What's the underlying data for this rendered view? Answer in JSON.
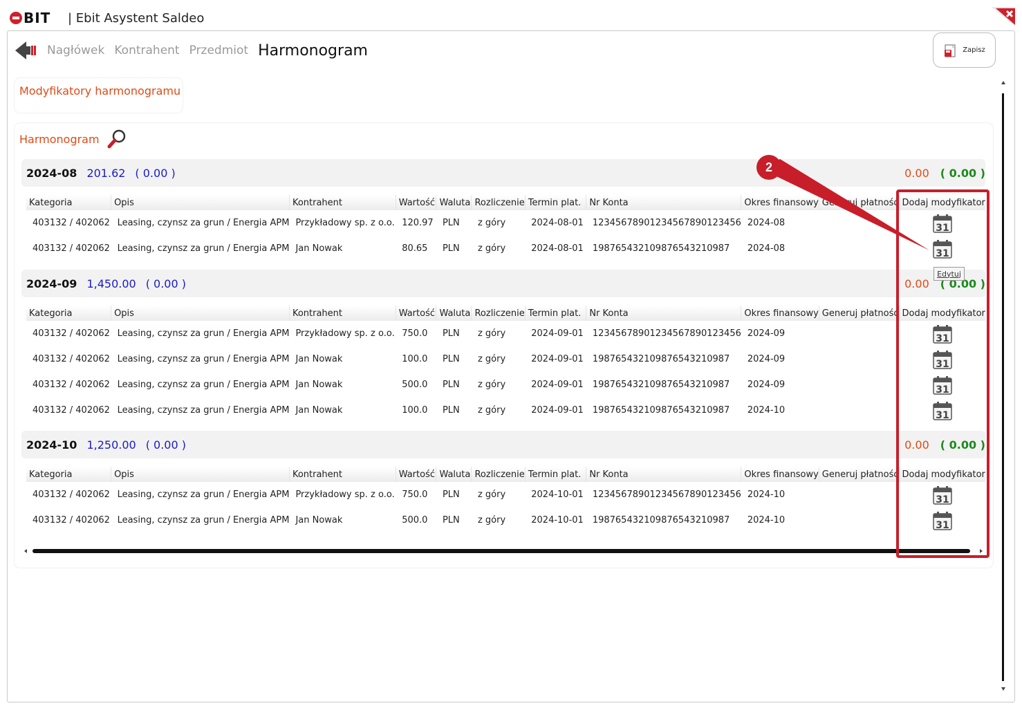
{
  "titlebar": {
    "logo": "BIT",
    "title": "| Ebit Asystent Saldeo"
  },
  "nav": {
    "tabs": [
      "Nagłówek",
      "Kontrahent",
      "Przedmiot"
    ],
    "active": "Harmonogram"
  },
  "toolbar": {
    "save_label": "Zapisz"
  },
  "modifiers_title": "Modyfikatory harmonogramu",
  "harmonogram_title": "Harmonogram",
  "columns": [
    "Kategoria",
    "Opis",
    "Kontrahent",
    "Wartość",
    "Waluta",
    "Rozliczenie",
    "Termin plat.",
    "Nr Konta",
    "Okres finansowy",
    "Generuj płatność",
    "Dodaj modyfikator"
  ],
  "groups": [
    {
      "period": "2024-08",
      "sum": "201.62",
      "paid": "( 0.00 )",
      "right_sum": "0.00",
      "right_paid": "( 0.00 )",
      "rows": [
        [
          "403132 / 402062",
          "Leasing, czynsz za grun / Energia APM",
          "Przykładowy sp. z o.o.",
          "120.97",
          "PLN",
          "z góry",
          "2024-08-01",
          "12345678901234567890123456",
          "2024-08"
        ],
        [
          "403132 / 402062",
          "Leasing, czynsz za grun / Energia APM",
          "Jan Nowak",
          "80.65",
          "PLN",
          "z góry",
          "2024-08-01",
          "19876543210987654321098​7",
          "2024-08"
        ]
      ]
    },
    {
      "period": "2024-09",
      "sum": "1,450.00",
      "paid": "( 0.00 )",
      "right_sum": "0.00",
      "right_paid": "( 0.00 )",
      "rows": [
        [
          "403132 / 402062",
          "Leasing, czynsz za grun / Energia APM",
          "Przykładowy sp. z o.o.",
          "750.0",
          "PLN",
          "z góry",
          "2024-09-01",
          "12345678901234567890123456",
          "2024-09"
        ],
        [
          "403132 / 402062",
          "Leasing, czynsz za grun / Energia APM",
          "Jan Nowak",
          "100.0",
          "PLN",
          "z góry",
          "2024-09-01",
          "19876543210987654321098​7",
          "2024-09"
        ],
        [
          "403132 / 402062",
          "Leasing, czynsz za grun / Energia APM",
          "Jan Nowak",
          "500.0",
          "PLN",
          "z góry",
          "2024-09-01",
          "19876543210987654321098​7",
          "2024-09"
        ],
        [
          "403132 / 402062",
          "Leasing, czynsz za grun / Energia APM",
          "Jan Nowak",
          "100.0",
          "PLN",
          "z góry",
          "2024-09-01",
          "19876543210987654321098​7",
          "2024-10"
        ]
      ]
    },
    {
      "period": "2024-10",
      "sum": "1,250.00",
      "paid": "( 0.00 )",
      "right_sum": "0.00",
      "right_paid": "( 0.00 )",
      "rows": [
        [
          "403132 / 402062",
          "Leasing, czynsz za grun / Energia APM",
          "Przykładowy sp. z o.o.",
          "750.0",
          "PLN",
          "z góry",
          "2024-10-01",
          "12345678901234567890123456",
          "2024-10"
        ],
        [
          "403132 / 402062",
          "Leasing, czynsz za grun / Energia APM",
          "Jan Nowak",
          "500.0",
          "PLN",
          "z góry",
          "2024-10-01",
          "19876543210987654321098​7",
          "2024-10"
        ]
      ]
    }
  ],
  "calendar_icon_text": "31",
  "tooltip": "Edytuj",
  "annotation_number": "2",
  "colors": {
    "accent": "#e04a17",
    "blue": "#1a1acc",
    "green": "#1c8a1c",
    "annotation": "#c81e2a"
  }
}
